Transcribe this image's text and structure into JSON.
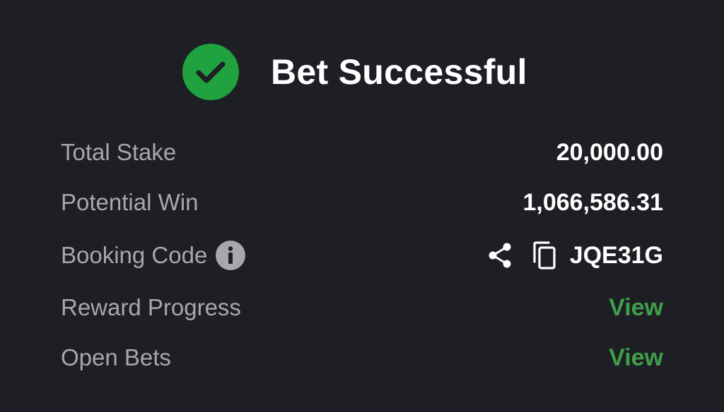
{
  "header": {
    "title": "Bet Successful",
    "icon": "check-circle-icon",
    "success_color": "#1fa23f"
  },
  "rows": {
    "total_stake": {
      "label": "Total Stake",
      "value": "20,000.00"
    },
    "potential_win": {
      "label": "Potential Win",
      "value": "1,066,586.31"
    },
    "booking_code": {
      "label": "Booking Code",
      "value": "JQE31G",
      "icons": [
        "info-icon",
        "share-icon",
        "copy-icon"
      ]
    },
    "reward_progress": {
      "label": "Reward Progress",
      "link": "View"
    },
    "open_bets": {
      "label": "Open Bets",
      "link": "View"
    }
  },
  "colors": {
    "background": "#1e1f24",
    "label": "#a7a8ae",
    "value": "#ffffff",
    "link": "#3f9e4a"
  }
}
